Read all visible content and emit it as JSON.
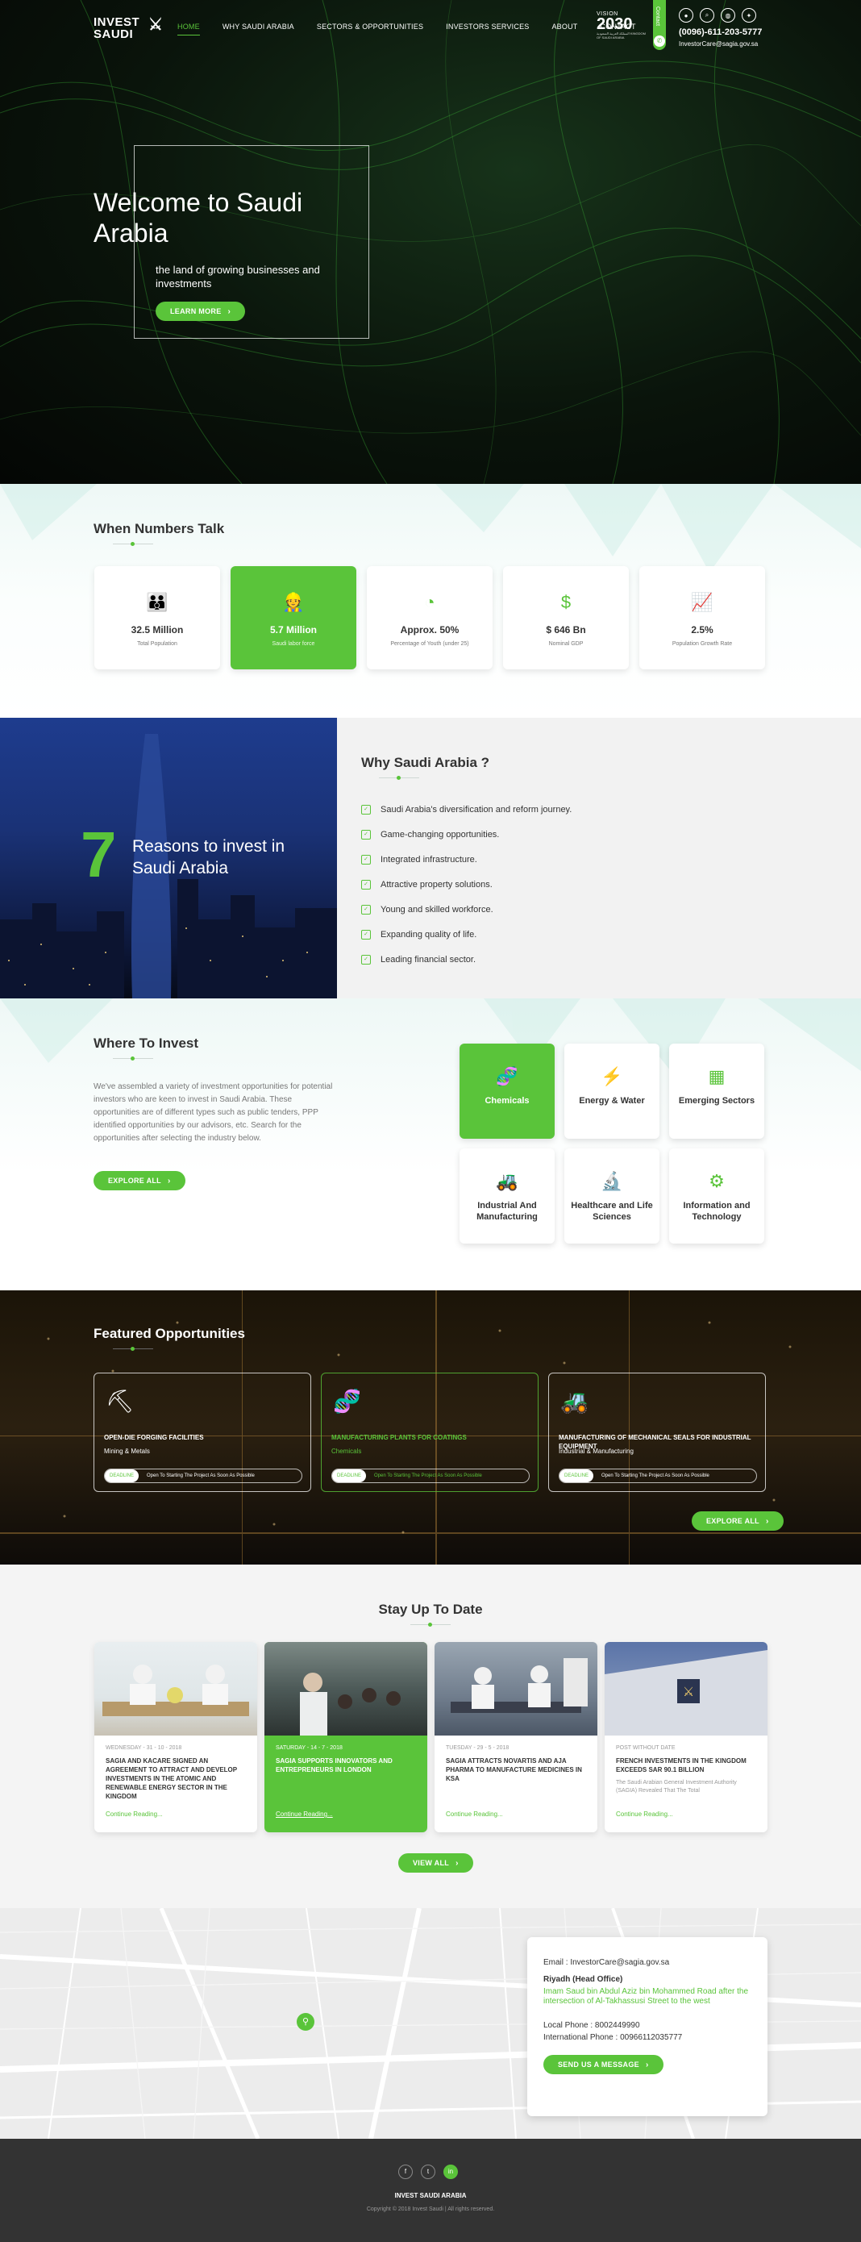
{
  "header": {
    "logo_line1": "INVEST",
    "logo_line2": "SAUDI",
    "nav": [
      "HOME",
      "WHY SAUDI ARABIA",
      "SECTORS & OPPORTUNITIES",
      "INVESTORS SERVICES",
      "ABOUT",
      "CONTACT"
    ],
    "vision_line1": "VISION",
    "vision_line2": "2030",
    "vision_line3": "المملكة العربية السعودية KINGDOM OF SAUDI ARABIA",
    "contact_tab": "Contact",
    "phone": "(0096)-611-203-5777",
    "email": "InvestorCare@sagia.gov.sa"
  },
  "hero": {
    "title": "Welcome to Saudi Arabia",
    "subtitle": "the land of growing businesses and investments",
    "button": "LEARN MORE"
  },
  "numbers": {
    "title": "When Numbers Talk",
    "stats": [
      {
        "value": "32.5 Million",
        "label": "Total Population",
        "icon": "people-icon"
      },
      {
        "value": "5.7 Million",
        "label": "Saudi labor force",
        "icon": "worker-icon"
      },
      {
        "value": "Approx. 50%",
        "label": "Percentage of Youth (under 25)",
        "icon": "pie-icon"
      },
      {
        "value": "$ 646 Bn",
        "label": "Nominal GDP",
        "icon": "gdp-icon"
      },
      {
        "value": "2.5%",
        "label": "Population Growth Rate",
        "icon": "growth-icon"
      }
    ]
  },
  "reasons": {
    "number": "7",
    "tagline": "Reasons to invest in Saudi Arabia",
    "title": "Why Saudi Arabia ?",
    "items": [
      "Saudi Arabia's diversification and reform journey.",
      "Game-changing opportunities.",
      "Integrated infrastructure.",
      "Attractive property solutions.",
      "Young and skilled workforce.",
      "Expanding quality of life.",
      "Leading financial sector."
    ]
  },
  "where": {
    "title": "Where To Invest",
    "text": "We've assembled a variety of investment opportunities for potential investors who are keen to invest in Saudi Arabia. These opportunities are of different types such as public tenders, PPP identified opportunities by our advisors, etc. Search for the opportunities after selecting the industry below.",
    "button": "EXPLORE ALL",
    "sectors": [
      {
        "name": "Chemicals",
        "icon": "dna-icon"
      },
      {
        "name": "Energy & Water",
        "icon": "energy-icon"
      },
      {
        "name": "Emerging Sectors",
        "icon": "building-icon"
      },
      {
        "name": "Industrial And Manufacturing",
        "icon": "excavator-icon"
      },
      {
        "name": "Healthcare and Life Sciences",
        "icon": "microscope-icon"
      },
      {
        "name": "Information and Technology",
        "icon": "tech-icon"
      }
    ]
  },
  "featured": {
    "title": "Featured Opportunities",
    "button": "EXPLORE ALL",
    "deadline_label": "DEADLINE",
    "items": [
      {
        "title": "OPEN-DIE FORGING FACILITIES",
        "category": "Mining & Metals",
        "deadline": "Open To Starting The Project As Soon As Possible",
        "icon": "pickaxe-icon"
      },
      {
        "title": "MANUFACTURING PLANTS FOR COATINGS",
        "category": "Chemicals",
        "deadline": "Open To Starting The Project As Soon As Possible",
        "icon": "dna-icon"
      },
      {
        "title": "MANUFACTURING OF MECHANICAL SEALS FOR INDUSTRIAL EQUIPMENT",
        "category": "Industrial & Manufacturing",
        "deadline": "Open To Starting The Project As Soon As Possible",
        "icon": "excavator-icon"
      }
    ]
  },
  "news": {
    "title": "Stay Up To Date",
    "button": "VIEW ALL",
    "more": "Continue Reading...",
    "items": [
      {
        "date": "WEDNESDAY - 31 - 10 - 2018",
        "title": "SAGIA AND KACARE SIGNED AN AGREEMENT TO ATTRACT AND DEVELOP INVESTMENTS IN THE ATOMIC AND RENEWABLE ENERGY SECTOR IN THE KINGDOM",
        "excerpt": ""
      },
      {
        "date": "SATURDAY - 14 - 7 - 2018",
        "title": "SAGIA SUPPORTS INNOVATORS AND ENTREPRENEURS IN LONDON",
        "excerpt": ""
      },
      {
        "date": "TUESDAY - 29 - 5 - 2018",
        "title": "SAGIA ATTRACTS NOVARTIS AND AJA PHARMA TO MANUFACTURE MEDICINES IN KSA",
        "excerpt": ""
      },
      {
        "date": "POST WITHOUT DATE",
        "title": "FRENCH INVESTMENTS IN THE KINGDOM EXCEEDS SAR 90.1 BILLION",
        "excerpt": "The Saudi Arabian General Investment Authority (SAGIA) Revealed That The Total"
      }
    ]
  },
  "contact": {
    "email": "Email : InvestorCare@sagia.gov.sa",
    "hq": "Riyadh (Head Office)",
    "address": "Imam Saud bin Abdul Aziz bin Mohammed Road after the intersection of Al-Takhassusi Street to the west",
    "local_phone": "Local Phone : 8002449990",
    "intl_phone": "International Phone : 00966112035777",
    "button": "SEND US A MESSAGE"
  },
  "footer": {
    "social": [
      "f",
      "t",
      "in"
    ],
    "name": "INVEST SAUDI ARABIA",
    "copyright": "Copyright © 2018 Invest Saudi | All rights reserved."
  },
  "colors": {
    "accent": "#5ac43a",
    "footer": "#333333"
  }
}
